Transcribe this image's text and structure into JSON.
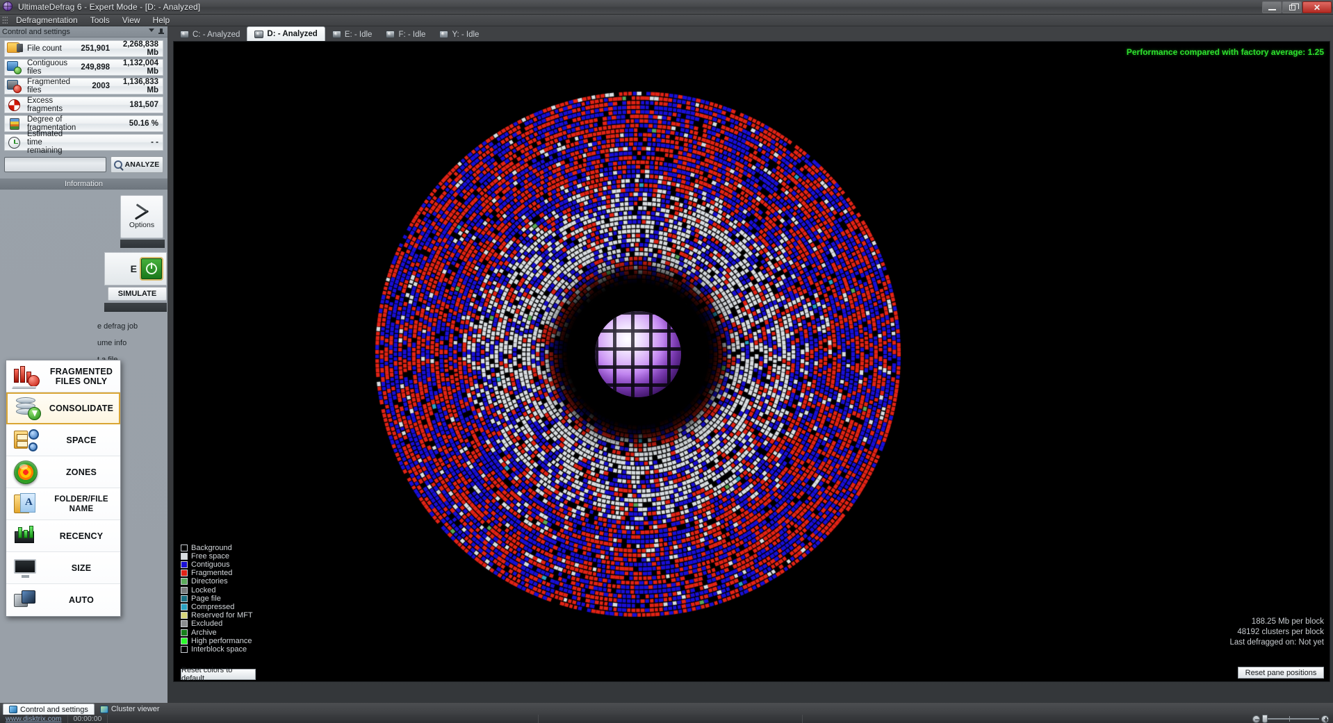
{
  "window": {
    "title": "UltimateDefrag 6 - Expert Mode - [D: - Analyzed]",
    "app_icon": "globe-icon",
    "minimize_label": "–",
    "maximize_label": "❐",
    "close_label": "✕"
  },
  "menubar": {
    "items": [
      {
        "label": "Defragmentation"
      },
      {
        "label": "Tools"
      },
      {
        "label": "View"
      },
      {
        "label": "Help"
      }
    ]
  },
  "left_panel": {
    "caption": "Control and settings",
    "stats": [
      {
        "icon": "folder-files-icon",
        "label": "File count",
        "count": "251,901",
        "size": "2,268,838 Mb"
      },
      {
        "icon": "contiguous-files-icon",
        "label": "Contiguous files",
        "count": "249,898",
        "size": "1,132,004 Mb"
      },
      {
        "icon": "fragmented-files-icon",
        "label": "Fragmented files",
        "count": "2003",
        "size": "1,136,833 Mb"
      },
      {
        "icon": "excess-fragments-icon",
        "label": "Excess fragments",
        "count": "",
        "size": "181,507"
      },
      {
        "icon": "degree-gauge-icon",
        "label": "Degree of fragmentation",
        "count": "",
        "size": "50.16 %"
      },
      {
        "icon": "stopwatch-icon",
        "label": "Estimated time remaining",
        "count": "",
        "size": "- -"
      }
    ],
    "progress_value": "",
    "analyze_button": "ANALYZE",
    "section_header": "Information",
    "options_button": "Options",
    "e_label": "E",
    "simulate_button": "SIMULATE",
    "links": [
      "e defrag job",
      "ume info",
      "t a file"
    ]
  },
  "method_menu": {
    "items": [
      {
        "label": "FRAGMENTED\nFILES ONLY",
        "icon": "fragmented-bars-icon",
        "selected": false
      },
      {
        "label": "CONSOLIDATE",
        "icon": "disk-stack-down-icon",
        "selected": true
      },
      {
        "label": "SPACE",
        "icon": "cabinet-gears-icon",
        "selected": false
      },
      {
        "label": "ZONES",
        "icon": "zones-target-icon",
        "selected": false
      },
      {
        "label": "FOLDER/FILE NAME",
        "icon": "folder-letter-icon",
        "selected": false
      },
      {
        "label": "RECENCY",
        "icon": "recency-chart-icon",
        "selected": false
      },
      {
        "label": "SIZE",
        "icon": "monitor-size-icon",
        "selected": false
      },
      {
        "label": "AUTO",
        "icon": "auto-disks-icon",
        "selected": false
      }
    ]
  },
  "main": {
    "tabs": [
      {
        "label": "C: - Analyzed",
        "icon": "drive-icon",
        "active": false
      },
      {
        "label": "D: - Analyzed",
        "icon": "drive-icon",
        "active": true
      },
      {
        "label": "E: - Idle",
        "icon": "drive-icon",
        "active": false
      },
      {
        "label": "F: - Idle",
        "icon": "drive-icon",
        "active": false
      },
      {
        "label": "Y: - Idle",
        "icon": "network-drive-icon",
        "active": false
      }
    ],
    "performance_text": "Performance compared with factory average: 1.25",
    "performance_color": "#2ee02e",
    "info_lines": [
      "188.25 Mb per block",
      "48192 clusters per block",
      "Last defragged on: Not yet"
    ],
    "reset_pane_button": "Reset pane positions",
    "reset_colors_button": "Reset colors to default",
    "legend": [
      {
        "label": "Background",
        "color": "#000000"
      },
      {
        "label": "Free space",
        "color": "#d8dce0"
      },
      {
        "label": "Contiguous",
        "color": "#1a0fd6"
      },
      {
        "label": "Fragmented",
        "color": "#e22316"
      },
      {
        "label": "Directories",
        "color": "#5aa95a"
      },
      {
        "label": "Locked",
        "color": "#77797b"
      },
      {
        "label": "Page file",
        "color": "#1b6f82"
      },
      {
        "label": "Compressed",
        "color": "#2aa3c4"
      },
      {
        "label": "Reserved for MFT",
        "color": "#d5d47a"
      },
      {
        "label": "Excluded",
        "color": "#8a8d8f"
      },
      {
        "label": "Archive",
        "color": "#16801a"
      },
      {
        "label": "High performance",
        "color": "#2bfb2b"
      },
      {
        "label": "Interblock space",
        "color": "#000000"
      }
    ]
  },
  "pane_tabs": [
    {
      "label": "Control and settings",
      "icon": "settings-icon",
      "active": true
    },
    {
      "label": "Cluster viewer",
      "icon": "cluster-icon",
      "active": false
    }
  ],
  "statusbar": {
    "website": "www.disktrix.com",
    "elapsed": "00:00:00",
    "zoom_minus": "−",
    "zoom_plus": "+"
  }
}
